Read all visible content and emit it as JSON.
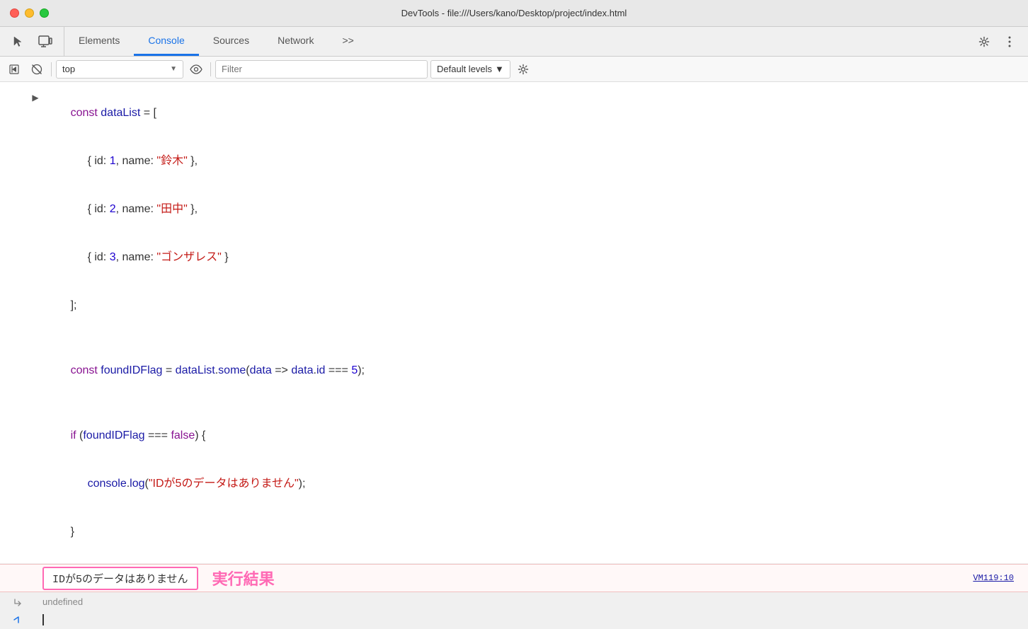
{
  "titlebar": {
    "title": "DevTools - file:///Users/kano/Desktop/project/index.html",
    "buttons": {
      "close": "close",
      "minimize": "minimize",
      "maximize": "maximize"
    }
  },
  "tabs": {
    "items": [
      {
        "label": "Elements",
        "active": false
      },
      {
        "label": "Console",
        "active": true
      },
      {
        "label": "Sources",
        "active": false
      },
      {
        "label": "Network",
        "active": false
      }
    ],
    "more_label": ">>",
    "settings_label": "⚙",
    "menu_label": "⋮"
  },
  "toolbar": {
    "run_label": "▶",
    "clear_label": "🚫",
    "context_label": "top",
    "context_arrow": "▼",
    "eye_label": "👁",
    "filter_placeholder": "Filter",
    "levels_label": "Default levels",
    "levels_arrow": "▼",
    "settings_label": "⚙"
  },
  "console": {
    "code_lines": [
      {
        "indent": 0,
        "content": "const dataList = ["
      },
      {
        "indent": 1,
        "content": "{ id: 1, name: \"鈴木\" },"
      },
      {
        "indent": 1,
        "content": "{ id: 2, name: \"田中\" },"
      },
      {
        "indent": 1,
        "content": "{ id: 3, name: \"ゴンザレス\" }"
      },
      {
        "indent": 0,
        "content": "];"
      },
      {
        "indent": 0,
        "content": ""
      },
      {
        "indent": 0,
        "content": "const foundIDFlag = dataList.some(data => data.id === 5);"
      },
      {
        "indent": 0,
        "content": ""
      },
      {
        "indent": 0,
        "content": "if (foundIDFlag === false) {"
      },
      {
        "indent": 1,
        "content": "console.log(\"IDが5のデータはありません\");"
      },
      {
        "indent": 0,
        "content": "}"
      }
    ],
    "log_output": "IDが5のデータはありません",
    "log_annotation": "実行結果",
    "log_location": "VM119:10",
    "undefined_text": "undefined"
  }
}
